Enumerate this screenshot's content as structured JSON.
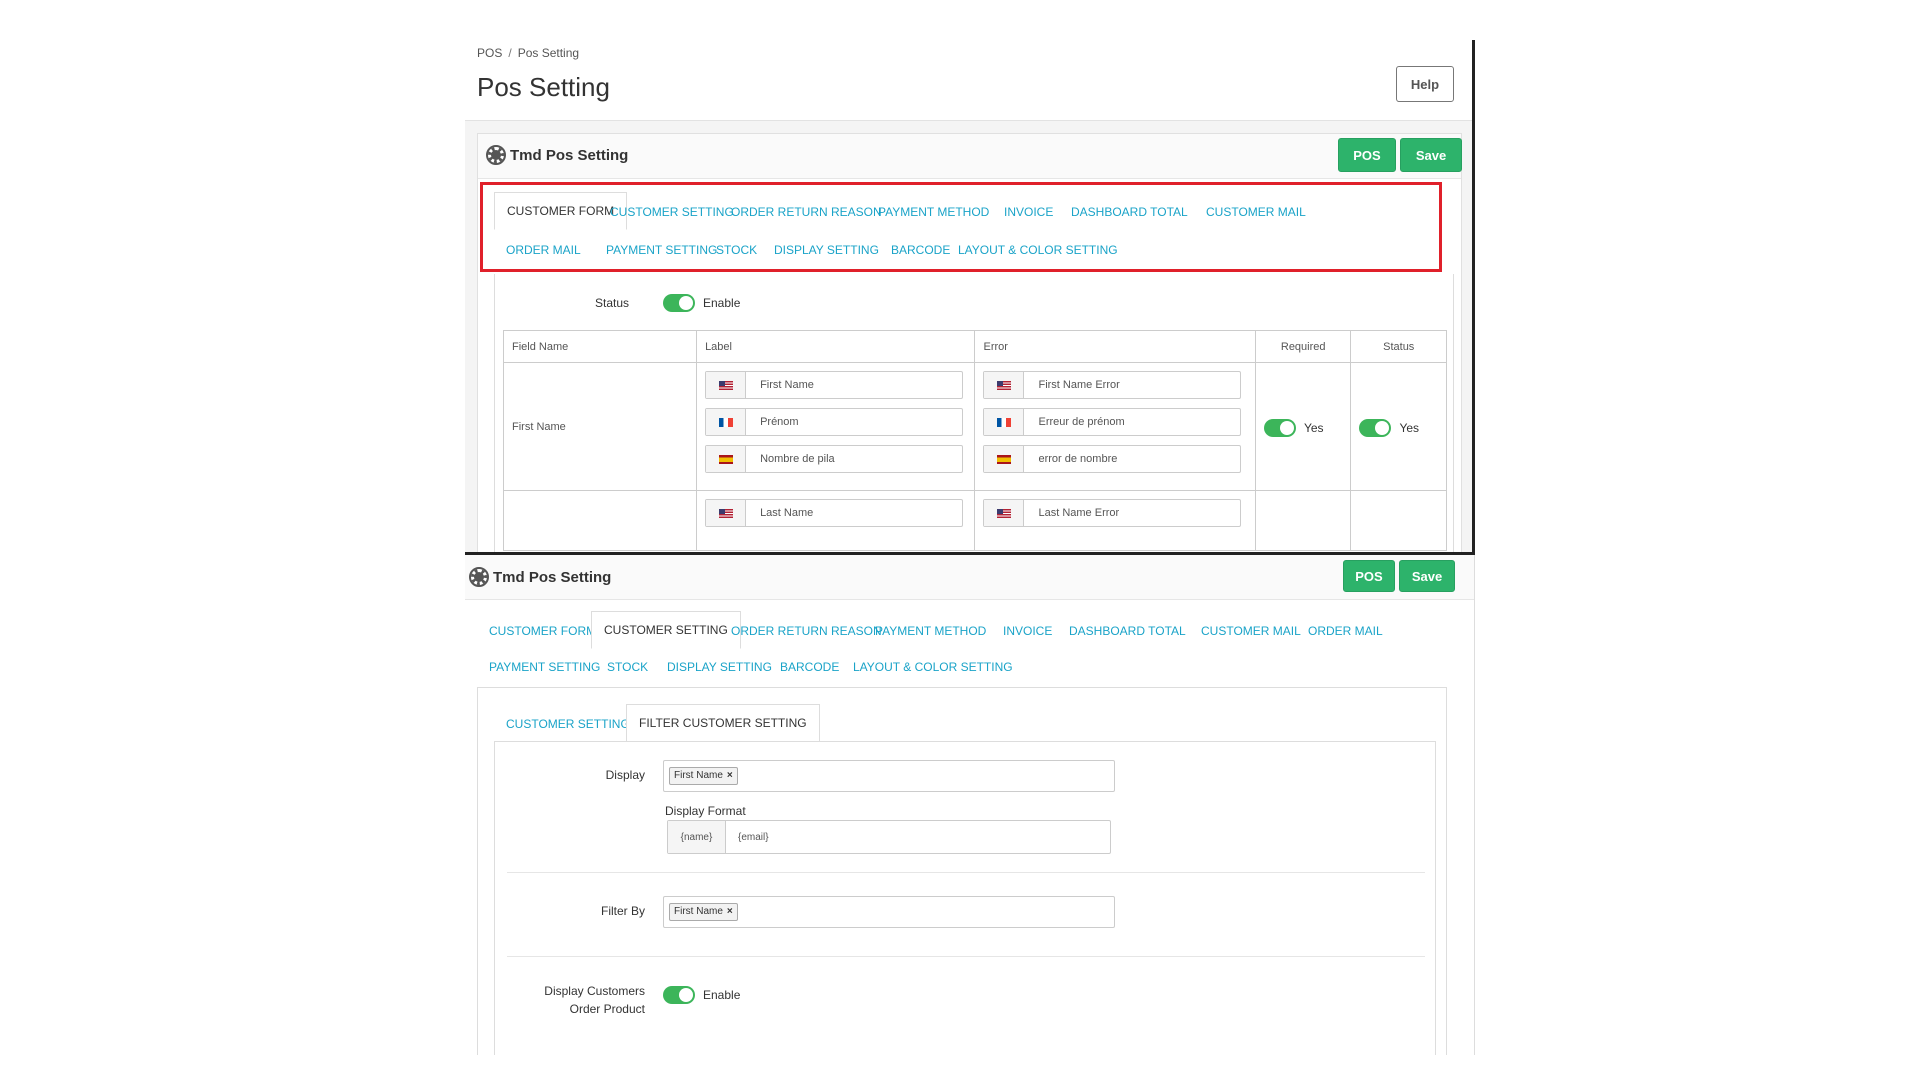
{
  "top": {
    "breadcrumb": [
      "POS",
      "Pos Setting"
    ],
    "breadcrumb_sep": "/",
    "page_title": "Pos Setting",
    "help_label": "Help",
    "panel_title": "Tmd Pos Setting",
    "pos_label": "POS",
    "save_label": "Save",
    "tabs_row1": [
      "CUSTOMER FORM",
      "CUSTOMER SETTING",
      "ORDER RETURN REASON",
      "PAYMENT METHOD",
      "INVOICE",
      "DASHBOARD TOTAL",
      "CUSTOMER MAIL"
    ],
    "tabs_row2": [
      "ORDER MAIL",
      "PAYMENT SETTING",
      "STOCK",
      "DISPLAY SETTING",
      "BARCODE",
      "LAYOUT & COLOR SETTING"
    ],
    "status_label": "Status",
    "status_value": "Enable",
    "table": {
      "headers": [
        "Field Name",
        "Label",
        "Error",
        "Required",
        "Status"
      ],
      "rows": [
        {
          "field": "First Name",
          "labels": [
            "First Name",
            "Prénom",
            "Nombre de pila"
          ],
          "errors": [
            "First Name Error",
            "Erreur de prénom",
            "error de nombre"
          ],
          "required": "Yes",
          "status": "Yes"
        },
        {
          "field": "",
          "labels": [
            "Last Name"
          ],
          "errors": [
            "Last Name Error"
          ],
          "required": "",
          "status": ""
        }
      ]
    }
  },
  "bottom": {
    "panel_title": "Tmd Pos Setting",
    "pos_label": "POS",
    "save_label": "Save",
    "tabs_row1": [
      "CUSTOMER FORM",
      "CUSTOMER SETTING",
      "ORDER RETURN REASON",
      "PAYMENT METHOD",
      "INVOICE",
      "DASHBOARD TOTAL",
      "CUSTOMER MAIL",
      "ORDER MAIL"
    ],
    "tabs_row2": [
      "PAYMENT SETTING",
      "STOCK",
      "DISPLAY SETTING",
      "BARCODE",
      "LAYOUT & COLOR SETTING"
    ],
    "sub_tabs": [
      "CUSTOMER SETTING",
      "FILTER CUSTOMER SETTING"
    ],
    "display_label": "Display",
    "display_chip": "First Name",
    "display_format_label": "Display Format",
    "format_addon": "{name}",
    "format_value": "{email}",
    "filter_label": "Filter By",
    "filter_chip": "First Name",
    "display_orders_label_1": "Display Customers",
    "display_orders_label_2": "Order Product",
    "display_orders_value": "Enable",
    "chip_remove": "×"
  },
  "colors": {
    "accent": "#1aa3c8",
    "green": "#2db36b",
    "highlight": "#e0202a"
  }
}
